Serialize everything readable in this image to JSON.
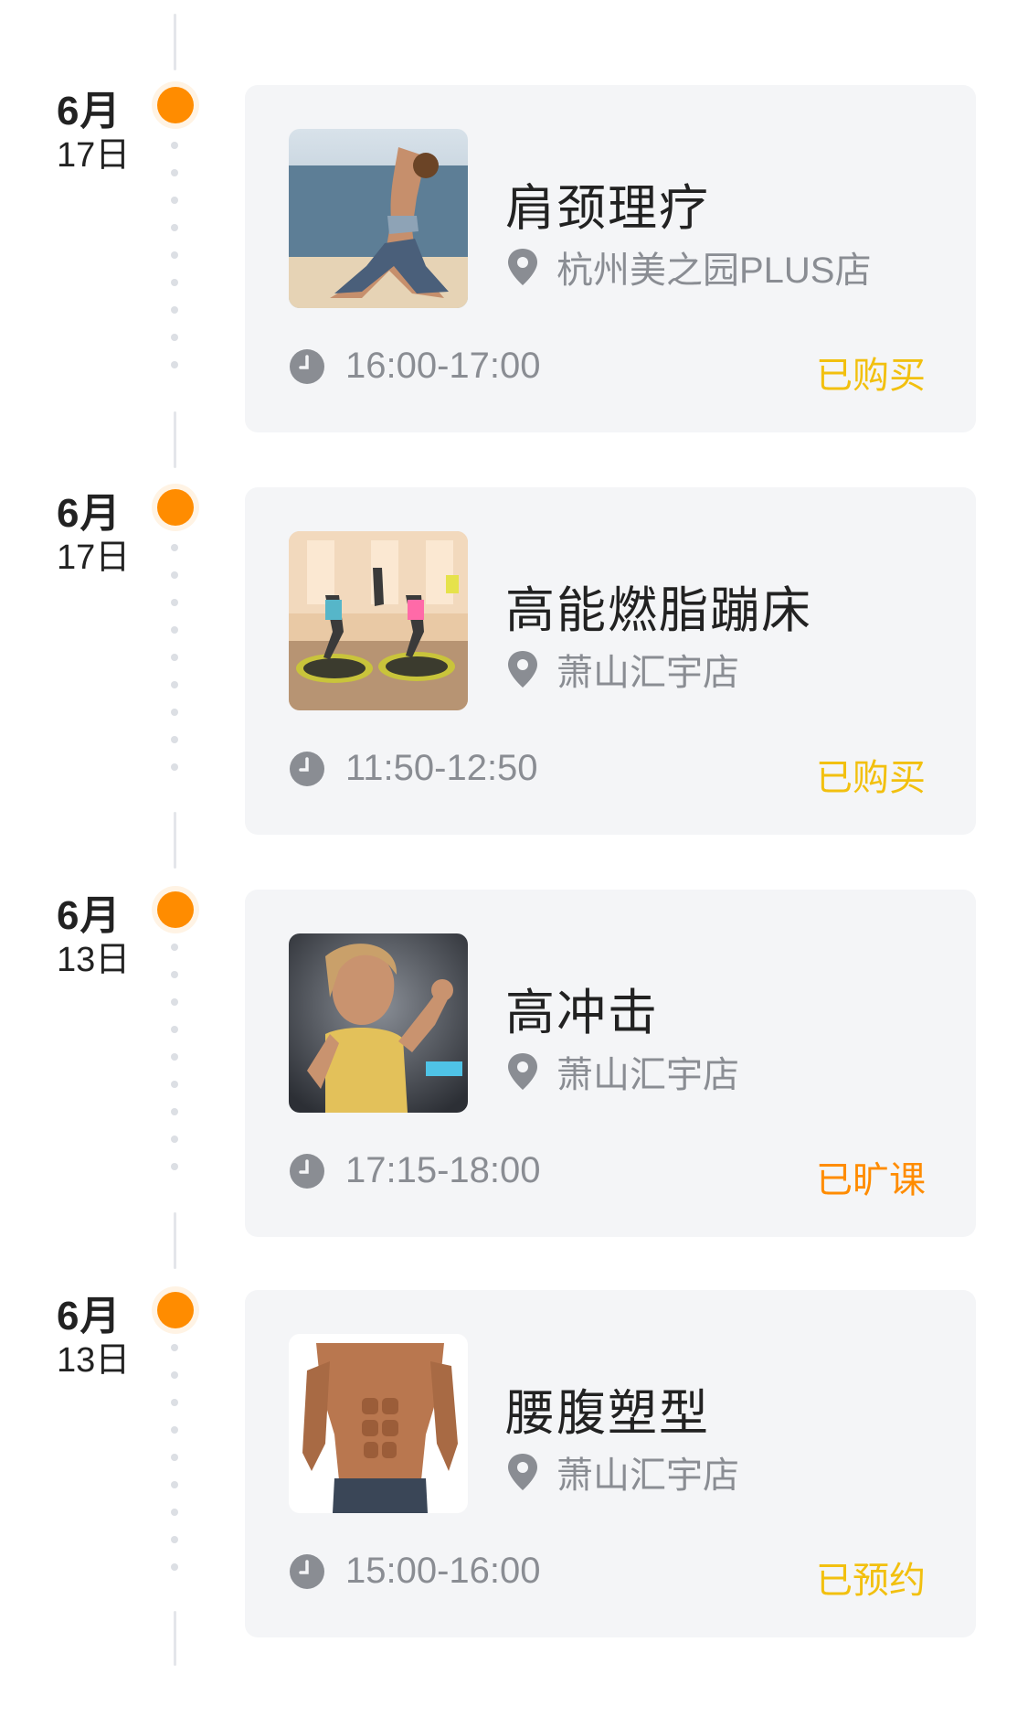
{
  "items": [
    {
      "month": "6月",
      "day": "17日",
      "title": "肩颈理疗",
      "location": "杭州美之园PLUS店",
      "time": "16:00-17:00",
      "status": "已购买",
      "status_color": "#f2c00f",
      "image_icon": "yoga-photo"
    },
    {
      "month": "6月",
      "day": "17日",
      "title": "高能燃脂蹦床",
      "location": "萧山汇宇店",
      "time": "11:50-12:50",
      "status": "已购买",
      "status_color": "#f2c00f",
      "image_icon": "trampoline-photo"
    },
    {
      "month": "6月",
      "day": "13日",
      "title": "高冲击",
      "location": "萧山汇宇店",
      "time": "17:15-18:00",
      "status": "已旷课",
      "status_color": "#ff8c00",
      "image_icon": "boxing-photo"
    },
    {
      "month": "6月",
      "day": "13日",
      "title": "腰腹塑型",
      "location": "萧山汇宇店",
      "time": "15:00-16:00",
      "status": "已预约",
      "status_color": "#f2c00f",
      "image_icon": "abs-photo"
    }
  ],
  "colors": {
    "accent": "#ff8c00",
    "card_bg": "#f4f5f7",
    "muted": "#8a8d93"
  }
}
